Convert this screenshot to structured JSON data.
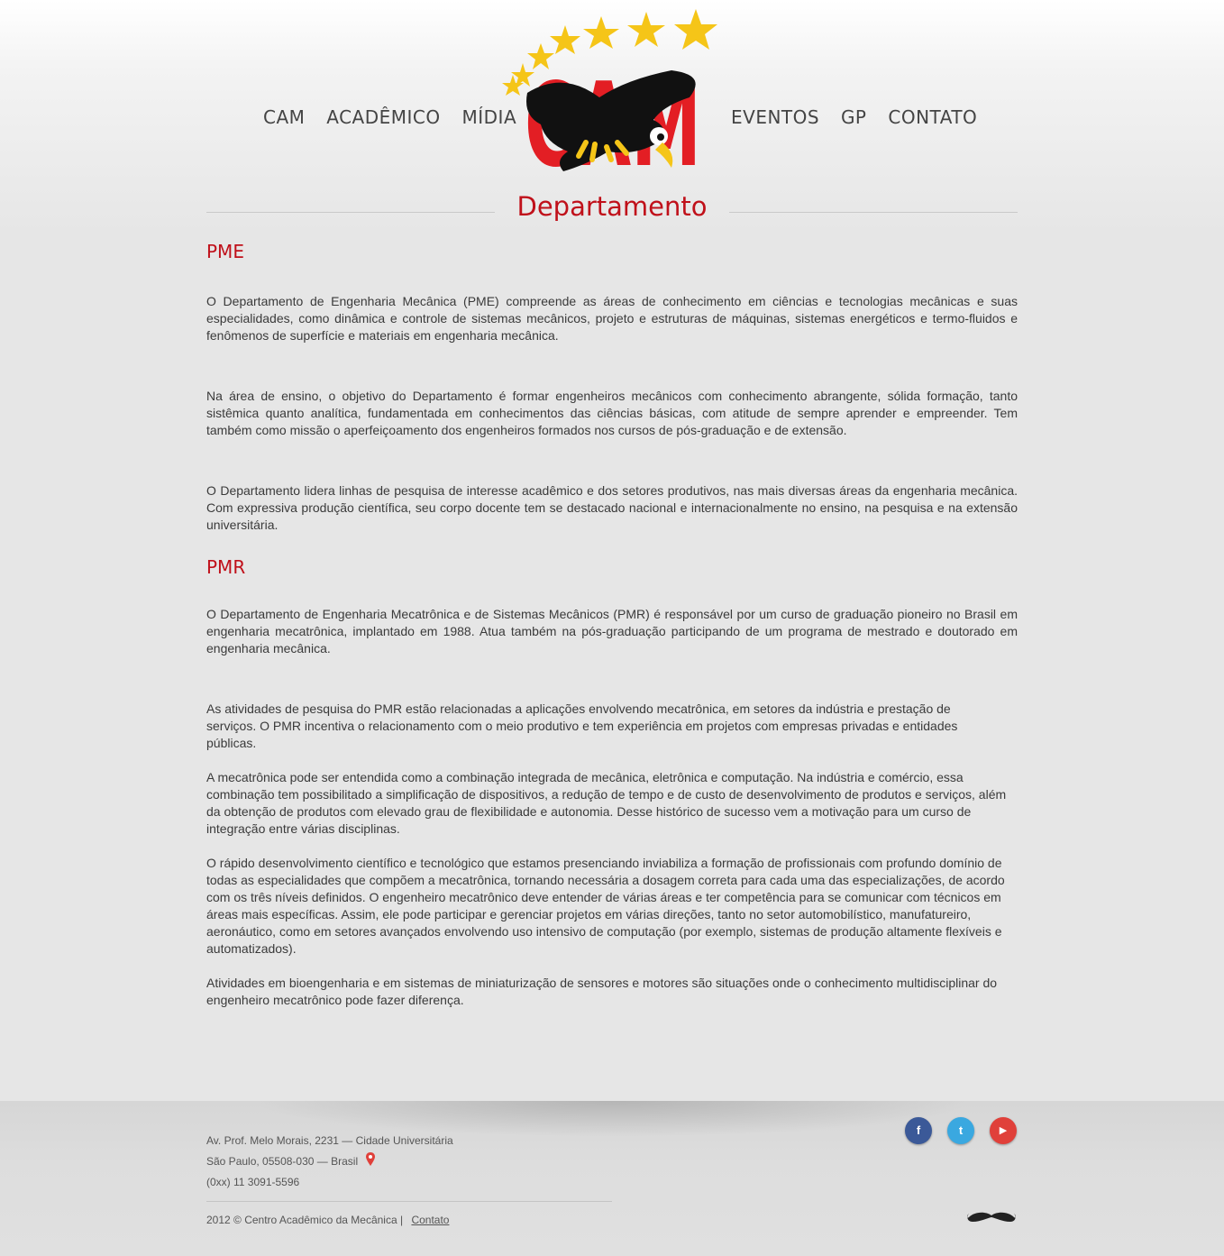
{
  "nav": {
    "left": [
      "CAM",
      "ACADÊMICO",
      "MÍDIA"
    ],
    "right": [
      "EVENTOS",
      "GP",
      "CONTATO"
    ]
  },
  "logo": {
    "text": "CAM"
  },
  "page": {
    "title": "Departamento"
  },
  "sections": {
    "pme": {
      "heading": "PME",
      "p1": "O Departamento de Engenharia Mecânica (PME) compreende as áreas de conhecimento em ciências e tecnologias mecânicas e suas especialidades, como dinâmica e controle de sistemas mecânicos, projeto e estruturas de máquinas, sistemas energéticos e termo-fluidos e fenômenos de superfície e materiais em engenharia mecânica.",
      "p2": "Na área de ensino, o objetivo do Departamento é formar engenheiros mecânicos com conhecimento abrangente, sólida formação, tanto sistêmica quanto analítica, fundamentada em conhecimentos das ciências básicas, com atitude de sempre aprender e empreender. Tem também como missão o aperfeiçoamento dos engenheiros formados nos cursos de pós-graduação e de extensão.",
      "p3": "O Departamento lidera linhas de pesquisa de interesse acadêmico e dos setores produtivos, nas mais diversas áreas da engenharia mecânica. Com expressiva produção científica, seu corpo docente tem se destacado nacional e internacionalmente no ensino, na pesquisa e na extensão universitária."
    },
    "pmr": {
      "heading": "PMR",
      "p1": "O Departamento de Engenharia Mecatrônica e de Sistemas Mecânicos (PMR) é responsável por um curso de graduação pioneiro no Brasil em engenharia mecatrônica, implantado em 1988.  Atua também na pós-graduação participando de um programa de mestrado e doutorado em engenharia mecânica.",
      "p2": "As atividades de pesquisa do PMR estão relacionadas a aplicações envolvendo mecatrônica, em setores da indústria e prestação de serviços.  O PMR incentiva o relacionamento com o meio produtivo e tem experiência em projetos com empresas privadas e entidades públicas.",
      "p3": "A mecatrônica pode ser entendida como a combinação integrada de mecânica, eletrônica e computação. Na indústria e comércio, essa combinação tem possibilitado a simplificação de dispositivos, a redução de tempo e de custo de desenvolvimento de produtos e serviços, além da obtenção de produtos com elevado grau de flexibilidade e autonomia. Desse histórico de sucesso vem a motivação para um curso de integração entre várias disciplinas.",
      "p4": "O rápido desenvolvimento científico e tecnológico que estamos presenciando inviabiliza a formação de profissionais com profundo domínio de todas as especialidades que compõem a mecatrônica, tornando necessária a dosagem correta para cada uma das especializações, de acordo com os três níveis definidos. O engenheiro mecatrônico deve entender de várias áreas e ter competência para se comunicar com técnicos em áreas mais específicas. Assim, ele pode participar e gerenciar projetos em várias direções, tanto no setor automobilístico, manufatureiro, aeronáutico, como em setores avançados envolvendo uso intensivo de computação (por exemplo, sistemas de produção altamente flexíveis e automatizados).",
      "p5": "Atividades em bioengenharia e em sistemas de miniaturização de sensores e motores são situações onde o conhecimento multidisciplinar do engenheiro mecatrônico pode fazer diferença."
    }
  },
  "footer": {
    "address_line1": "Av. Prof. Melo Morais, 2231 — Cidade Universitária",
    "address_line2": "São Paulo, 05508-030 — Brasil",
    "phone": "(0xx) 11 3091-5596",
    "copyright": "2012 © Centro Acadêmico da Mecânica  |",
    "contact_link": "Contato",
    "social": {
      "facebook": "f",
      "twitter": "t",
      "youtube": "▶"
    },
    "colors": {
      "facebook": "#3b5998",
      "twitter": "#3aa8e0",
      "youtube": "#e0403a"
    }
  },
  "colors": {
    "accent": "#c0101a",
    "star": "#f5c518"
  }
}
